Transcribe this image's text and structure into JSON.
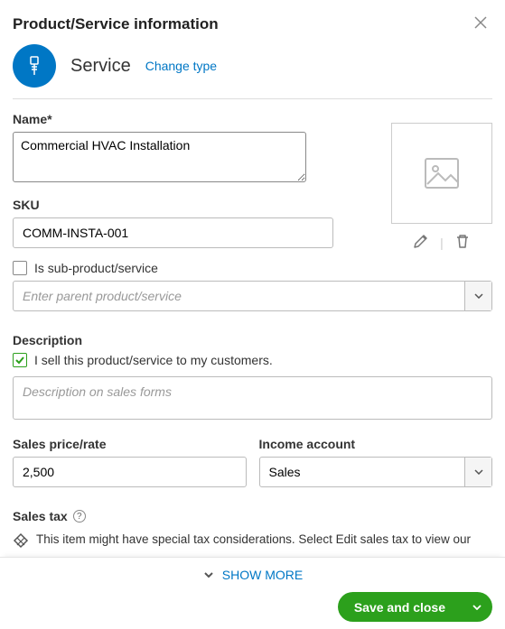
{
  "panel": {
    "title": "Product/Service information",
    "type_name": "Service",
    "change_type_label": "Change type"
  },
  "fields": {
    "name_label": "Name*",
    "name_value": "Commercial HVAC Installation",
    "sku_label": "SKU",
    "sku_value": "COMM-INSTA-001",
    "sub_product_label": "Is sub-product/service",
    "parent_placeholder": "Enter parent product/service",
    "description_label": "Description",
    "sell_checkbox_label": "I sell this product/service to my customers.",
    "description_placeholder": "Description on sales forms",
    "price_label": "Sales price/rate",
    "price_value": "2,500",
    "income_label": "Income account",
    "income_value": "Sales",
    "sales_tax_label": "Sales tax",
    "tax_message": "This item might have special tax considerations. Select Edit sales tax to view our"
  },
  "actions": {
    "show_more": "SHOW MORE",
    "save": "Save and close"
  }
}
